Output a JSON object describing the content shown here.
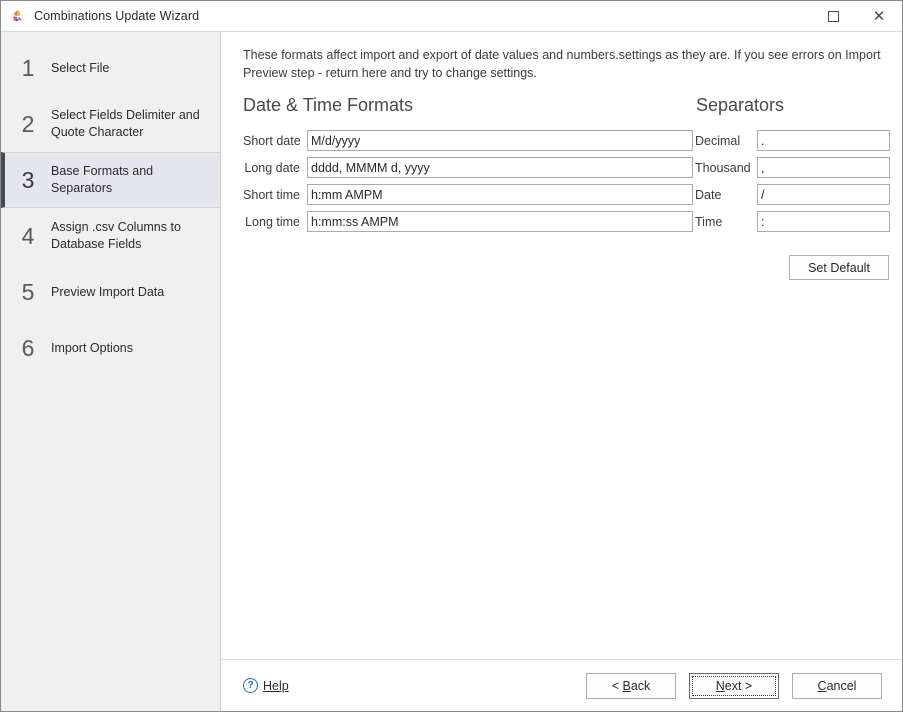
{
  "window": {
    "title": "Combinations Update Wizard",
    "icon": "butterfly-icon",
    "controls": {
      "maximize": "maximize-icon",
      "close": "close-icon"
    }
  },
  "sidebar": {
    "steps": [
      {
        "number": "1",
        "label": "Select File",
        "active": false
      },
      {
        "number": "2",
        "label": "Select Fields Delimiter and Quote Character",
        "active": false
      },
      {
        "number": "3",
        "label": "Base Formats and Separators",
        "active": true
      },
      {
        "number": "4",
        "label": "Assign .csv Columns to Database Fields",
        "active": false
      },
      {
        "number": "5",
        "label": "Preview Import Data",
        "active": false
      },
      {
        "number": "6",
        "label": "Import Options",
        "active": false
      }
    ]
  },
  "main": {
    "intro": "These formats affect import and export of date values and numbers.settings as they are. If you see errors on Import Preview step - return here and try to change settings.",
    "datetime": {
      "heading": "Date & Time Formats",
      "fields": [
        {
          "label": "Short date",
          "value": "M/d/yyyy"
        },
        {
          "label": "Long date",
          "value": "dddd, MMMM d, yyyy"
        },
        {
          "label": "Short time",
          "value": "h:mm AMPM"
        },
        {
          "label": "Long time",
          "value": "h:mm:ss AMPM"
        }
      ]
    },
    "separators": {
      "heading": "Separators",
      "fields": [
        {
          "label": "Decimal",
          "value": "."
        },
        {
          "label": "Thousand",
          "value": ","
        },
        {
          "label": "Date",
          "value": "/"
        },
        {
          "label": "Time",
          "value": ":"
        }
      ],
      "set_default_label": "Set Default"
    }
  },
  "footer": {
    "help_label": "Help",
    "help_icon": "question-mark-icon",
    "back_label": "< Back",
    "back_mnemonic": "B",
    "next_label": "Next >",
    "next_mnemonic": "N",
    "cancel_label": "Cancel",
    "cancel_mnemonic": "C"
  },
  "colors": {
    "sidebar_bg": "#f0f0f0",
    "active_step_bg": "#e6e6ee",
    "active_step_accent": "#4a4a55",
    "link_blue": "#1a6fc4",
    "window_bg": "#ffffff"
  }
}
